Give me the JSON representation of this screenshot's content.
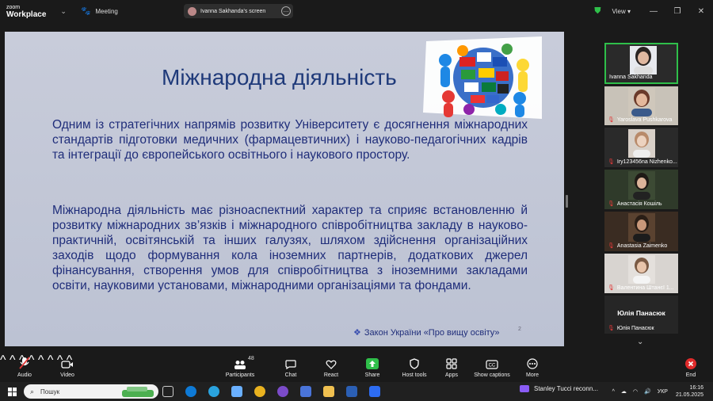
{
  "topbar": {
    "logo_line1": "zoom",
    "logo_line2": "Workplace",
    "meeting_label": "Meeting",
    "screen_share_label": "Ivanna Sakhanda's screen",
    "more_label": "…",
    "view_label": "View",
    "view_caret": "▾",
    "minimize": "—",
    "restore": "❐",
    "close": "✕",
    "chevron": "⌄"
  },
  "slide": {
    "title": "Міжнародна діяльність",
    "paragraph1": "Одним із стратегічних напрямів розвитку Університету є досягнення міжнародних стандартів підготовки медичних (фармацевтичних) і науково-педагогічних кадрів та інтеграції до європейського освітнього і наукового простору.",
    "paragraph2": "Міжнародна діяльність має різноаспектний характер та сприяє встановленню й розвитку міжнародних зв’язків і міжнародного співробітництва закладу в науково-практичній, освітянській та інших галузях, шляхом здійснення організаційних заходів щодо формування кола іноземних партнерів, додаткових джерел фінансування, створення умов для співробітництва з іноземними закладами освіти, науковими установами, міжнародними організаціями та фондами.",
    "footnote_bullet": "❖",
    "footnote": "Закон України «Про вищу освіту»",
    "page_number": "2"
  },
  "participants": [
    {
      "name": "Ivanna Sakhanda",
      "muted": false
    },
    {
      "name": "Yaroslava Pushkarova",
      "muted": true
    },
    {
      "name": "Iry123456na Nizhenko...",
      "muted": true
    },
    {
      "name": "Анастасія Кошіль",
      "muted": true
    },
    {
      "name": "Anastasia Zaimenko",
      "muted": true
    },
    {
      "name": "Валентина Штанєї 1...",
      "muted": true
    },
    {
      "name": "Юлія Панасюк",
      "muted": true,
      "big_name": "Юлія Панасюк"
    }
  ],
  "participants_more": "⌄",
  "toolbar": {
    "audio": "Audio",
    "video": "Video",
    "participants": "Participants",
    "participants_count": "48",
    "chat": "Chat",
    "react": "React",
    "share": "Share",
    "host_tools": "Host tools",
    "apps": "Apps",
    "show_captions": "Show captions",
    "more": "More",
    "end": "End",
    "caret": "^"
  },
  "taskbar": {
    "search_placeholder": "Пошук",
    "notification": "Stanley Tucci reconn...",
    "tray_up": "^",
    "language": "УКР",
    "time": "16:16",
    "date": "21.05.2025"
  },
  "colors": {
    "active_speaker": "#2fbf4a",
    "slide_text": "#1f2d7a",
    "end_button": "#e02b2b",
    "share_button": "#2fbf4a",
    "mute": "#e03a3a"
  }
}
